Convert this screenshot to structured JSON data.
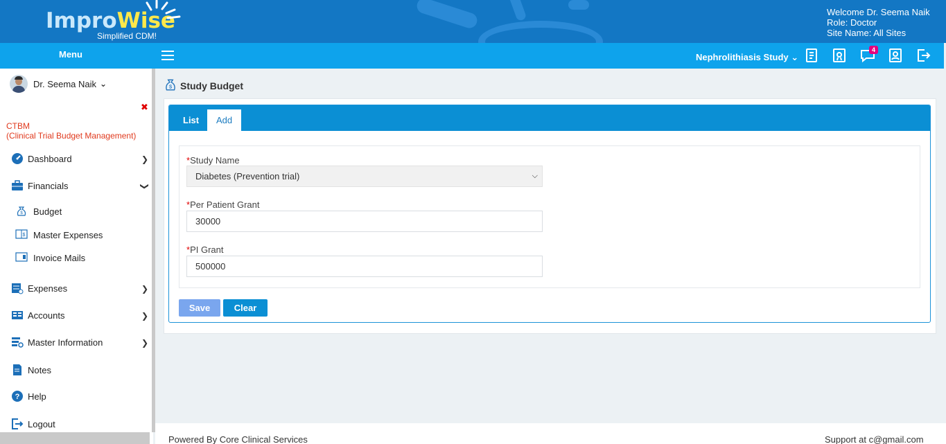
{
  "header": {
    "logo_impro": "Impro",
    "logo_wise": "Wise",
    "logo_tagline": "Simplified CDM!",
    "welcome": "Welcome  Dr. Seema Naik",
    "role": "Role:  Doctor",
    "site": "Site Name:  All Sites"
  },
  "menubar": {
    "menu_label": "Menu",
    "study": "Nephrolithiasis Study",
    "notification_count": "4"
  },
  "sidebar": {
    "user_name": "Dr. Seema Naik",
    "close": "✖",
    "module_title": "CTBM",
    "module_subtitle": "(Clinical Trial Budget Management)",
    "items": [
      {
        "label": "Dashboard",
        "icon": "dashboard-icon"
      },
      {
        "label": "Financials",
        "icon": "briefcase-icon"
      },
      {
        "label": "Expenses",
        "icon": "expenses-icon"
      },
      {
        "label": "Accounts",
        "icon": "accounts-icon"
      },
      {
        "label": "Master Information",
        "icon": "master-info-icon"
      },
      {
        "label": "Notes",
        "icon": "notes-icon"
      },
      {
        "label": "Help",
        "icon": "help-icon"
      },
      {
        "label": "Logout",
        "icon": "logout-icon"
      }
    ],
    "sub_items": [
      {
        "label": "Budget",
        "icon": "money-bag-icon"
      },
      {
        "label": "Master Expenses",
        "icon": "ledger-icon"
      },
      {
        "label": "Invoice Mails",
        "icon": "invoice-icon"
      }
    ]
  },
  "page": {
    "title": "Study Budget",
    "tabs": [
      "List",
      "Add"
    ],
    "active_tab": "Add"
  },
  "form": {
    "study_name_label": "Study Name",
    "study_name_value": "Diabetes (Prevention trial)",
    "per_patient_label": "Per Patient Grant",
    "per_patient_value": "30000",
    "pi_grant_label": "PI Grant",
    "pi_grant_value": "500000",
    "required_mark": "*",
    "save_label": "Save",
    "clear_label": "Clear"
  },
  "footer": {
    "left": "Powered By Core Clinical Services",
    "right": "Support at c@gmail.com"
  },
  "colors": {
    "header_blue": "#1377c4",
    "menubar_blue": "#0ea3ec",
    "tab_blue": "#0b8fd4",
    "save_button": "#7aa6ee",
    "ctbm_red": "#e0391d"
  }
}
